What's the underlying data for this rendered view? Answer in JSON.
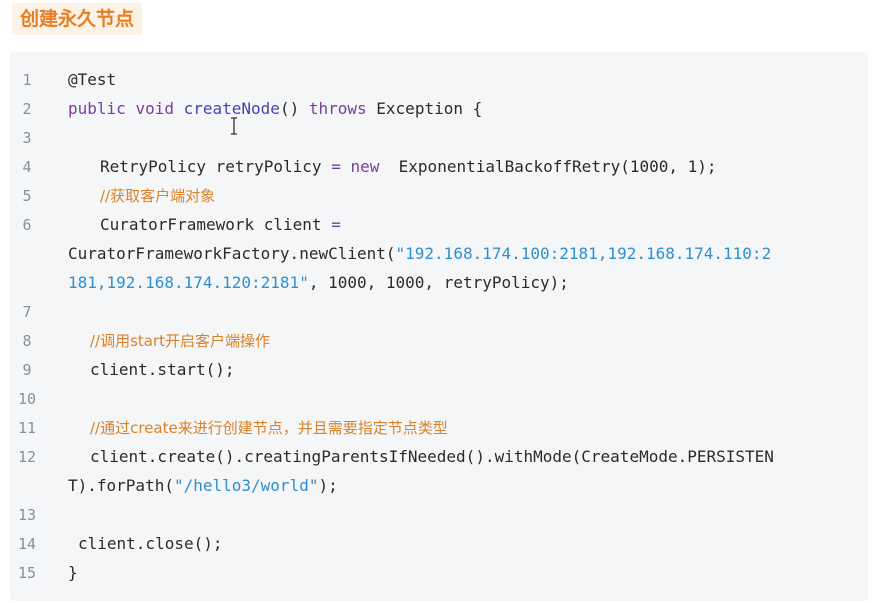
{
  "heading": "创建永久节点",
  "line_numbers": [
    "1",
    "2",
    "3",
    "4",
    "5",
    "6",
    "7",
    "8",
    "9",
    "10",
    "11",
    "12",
    "13",
    "14",
    "15"
  ],
  "code": {
    "l1": "@Test",
    "l2_kw1": "public",
    "l2_kw2": "void",
    "l2_fn": "createNode",
    "l2_paren": "()",
    "l2_kw3": "throws",
    "l2_rest": "Exception {",
    "l4_a": "RetryPolicy retryPolicy",
    "l4_op": "=",
    "l4_kw": "new",
    "l4_b": "ExponentialBackoffRetry",
    "l4_c": "(1000, 1);",
    "l5_comment": "//获取客户端对象",
    "l6_a": "CuratorFramework client",
    "l6_op": "=",
    "l6_wrap1_a": "CuratorFrameworkFactory.newClient(",
    "l6_wrap1_str": "\"192.168.174.100:2181,192.168.174.110:2",
    "l6_wrap2_str": "181,192.168.174.120:2181\"",
    "l6_wrap2_rest": ", 1000, 1000, retryPolicy);",
    "l8_comment": "//调用start开启客户端操作",
    "l9": "client.start();",
    "l11_comment": "//通过create来进行创建节点，并且需要指定节点类型",
    "l12_a": "client.create().creatingParentsIfNeeded().withMode(CreateMode.PERSISTEN",
    "l12_wrap_a": "T).forPath(",
    "l12_wrap_str": "\"/hello3/world\"",
    "l12_wrap_b": ");",
    "l14": "client.close();",
    "l15": "}"
  },
  "colors": {
    "heading": "#e67e22",
    "keyword": "#7a3e9d",
    "string": "#2f8fd0",
    "comment": "#d9822b",
    "background": "#f5f6f7"
  }
}
